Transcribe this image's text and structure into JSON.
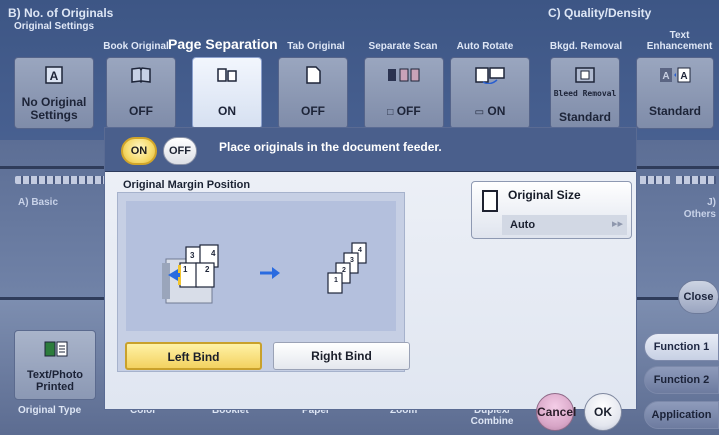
{
  "header": {
    "section_b": "B) No. of Originals",
    "section_c": "C) Quality/Density",
    "dialog_title": "Page Separation"
  },
  "columns": {
    "original_settings": "Original Settings",
    "book_original": "Book Original",
    "tab_original": "Tab Original",
    "separate_scan": "Separate Scan",
    "auto_rotate": "Auto Rotate",
    "bkgd_removal": "Bkgd. Removal",
    "text_enhancement": "Text Enhancement"
  },
  "buttons": {
    "no_original_settings": "No Original Settings",
    "book_original_value": "OFF",
    "page_separation_value": "ON",
    "tab_original_value": "OFF",
    "separate_scan_value": "OFF",
    "auto_rotate_value": "ON",
    "bleed_removal_small": "Bleed Removal",
    "bleed_removal_value": "Standard",
    "text_enhancement_value": "Standard"
  },
  "side": {
    "basic_label": "A) Basic",
    "others_label": "J) Others",
    "close": "Close",
    "text_photo_printed": "Text/Photo Printed",
    "original_type": "Original Type",
    "color": "Color",
    "booklet": "Booklet",
    "paper": "Paper",
    "zoom": "Zoom",
    "duplex_combine": "Duplex/ Combine"
  },
  "function_tabs": {
    "function1": "Function 1",
    "function2": "Function 2",
    "application": "Application"
  },
  "dialog": {
    "on": "ON",
    "off": "OFF",
    "message": "Place originals in the document feeder.",
    "margin_title": "Original Margin Position",
    "left_bind": "Left Bind",
    "right_bind": "Right Bind",
    "original_size_label": "Original Size",
    "original_size_value": "Auto",
    "cancel": "Cancel",
    "ok": "OK"
  }
}
